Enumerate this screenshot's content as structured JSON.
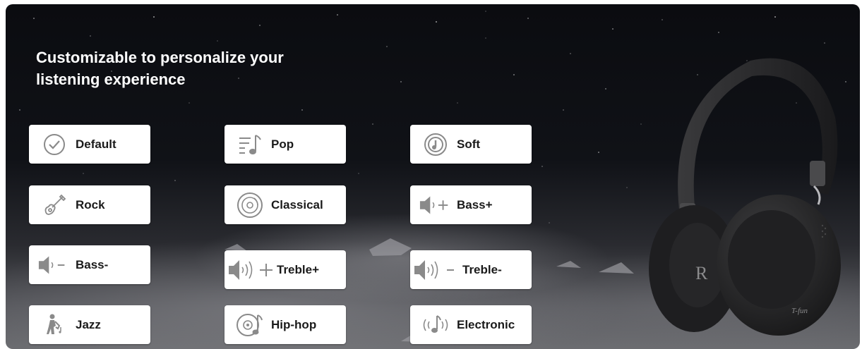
{
  "banner": {
    "headline_line1": "Customizable to personalize your",
    "headline_line2": "listening experience"
  },
  "eq_modes": [
    {
      "label": "Default",
      "icon": "check-circle-icon"
    },
    {
      "label": "Pop",
      "icon": "music-list-icon"
    },
    {
      "label": "Soft",
      "icon": "soft-disc-icon"
    },
    {
      "label": "Rock",
      "icon": "guitar-icon"
    },
    {
      "label": "Classical",
      "icon": "vinyl-disc-icon"
    },
    {
      "label": "Bass+",
      "icon": "speaker-plus-icon"
    },
    {
      "label": "Bass-",
      "icon": "speaker-minus-icon"
    },
    {
      "label": "Treble+",
      "icon": "speaker-waves-plus-icon"
    },
    {
      "label": "Treble-",
      "icon": "speaker-waves-minus-icon"
    },
    {
      "label": "Jazz",
      "icon": "saxophone-player-icon"
    },
    {
      "label": "Hip-hop",
      "icon": "disc-note-icon"
    },
    {
      "label": "Electronic",
      "icon": "note-waves-icon"
    }
  ],
  "product": {
    "cup_logo": "R",
    "brand_mark": "T-fun"
  },
  "colors": {
    "button_bg": "#ffffff",
    "icon_gray": "#8a8a8a",
    "label_text": "#1a1a1a",
    "headline_text": "#ffffff"
  }
}
